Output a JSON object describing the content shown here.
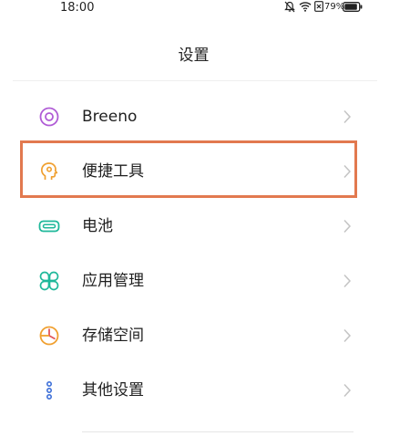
{
  "status_bar": {
    "time": "18:00",
    "battery_percent": "79%"
  },
  "page": {
    "title": "设置"
  },
  "settings": {
    "items": [
      {
        "label": "Breeno",
        "icon": "breeno-icon",
        "color": "#b05cd6"
      },
      {
        "label": "便捷工具",
        "icon": "convenience-tools-icon",
        "color": "#f0a030",
        "highlighted": true
      },
      {
        "label": "电池",
        "icon": "battery-icon",
        "color": "#1fb89a"
      },
      {
        "label": "应用管理",
        "icon": "app-management-icon",
        "color": "#1fb89a"
      },
      {
        "label": "存储空间",
        "icon": "storage-icon",
        "color": "#f0a030"
      },
      {
        "label": "其他设置",
        "icon": "other-settings-icon",
        "color": "#3d6fd8"
      }
    ]
  },
  "colors": {
    "highlight_border": "#e2794f",
    "chevron": "#c4c4c4"
  }
}
